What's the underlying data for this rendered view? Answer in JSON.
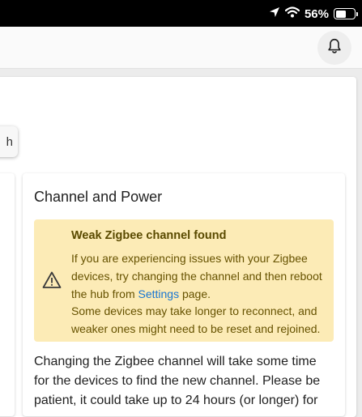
{
  "status_bar": {
    "battery_percent": "56%",
    "battery_level": 0.56,
    "icons": [
      "location-arrow-icon",
      "wifi-icon",
      "battery-icon"
    ]
  },
  "header": {
    "icons": [
      "bell-icon"
    ]
  },
  "search_button": {
    "label_fragment": "h"
  },
  "card": {
    "title": "Channel and Power",
    "alert": {
      "icon": "warning-icon",
      "title": "Weak Zigbee channel found",
      "text_before_link": "If you are experiencing issues with your Zigbee devices, try changing the channel and then reboot the hub from ",
      "link_text": "Settings",
      "text_after_link": " page.",
      "note": "Some devices may take longer to reconnect, and weaker ones might need to be reset and rejoined."
    },
    "body_text": "Changing the Zigbee channel will take some time for the devices to find the new channel. Please be patient, it could take up to 24 hours (or longer) for"
  },
  "colors": {
    "alert_background": "#fcebb6",
    "alert_text": "#665200",
    "link": "#1976d2"
  }
}
